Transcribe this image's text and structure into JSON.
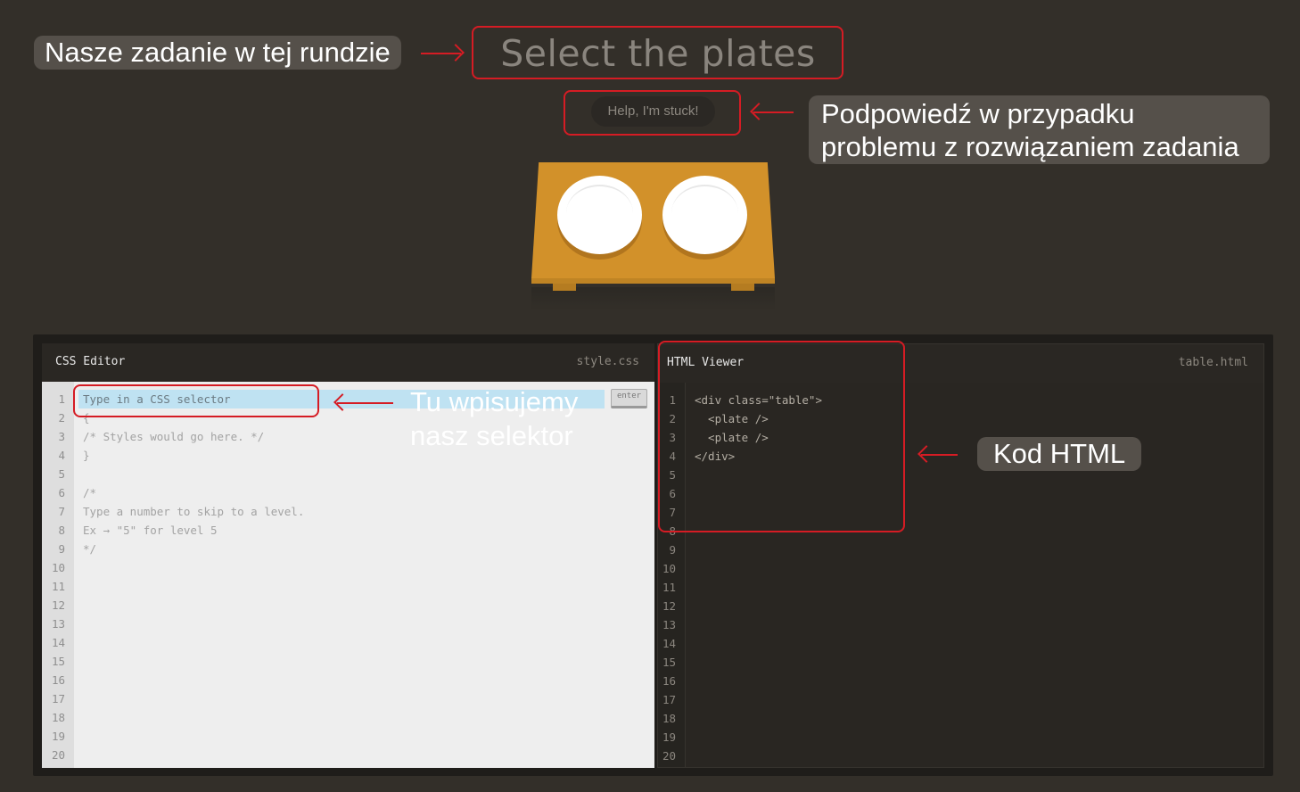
{
  "annotations": {
    "task": "Nasze zadanie w tej rundzie",
    "hint_line1": "Podpowiedź w przypadku",
    "hint_line2": "problemu z rozwiązaniem zadania",
    "selector_line1": "Tu wpisujemy",
    "selector_line2": "nasz selektor",
    "html": "Kod HTML"
  },
  "game": {
    "order": "Select the plates",
    "help_label": "Help, I'm stuck!",
    "plate_count": 2
  },
  "css_editor": {
    "title": "CSS Editor",
    "file": "style.css",
    "input_placeholder": "Type in a CSS selector",
    "enter_label": "enter",
    "lines": [
      "{",
      "/* Styles would go here. */",
      "}",
      "",
      "/*",
      "Type a number to skip to a level.",
      "Ex → \"5\" for level 5",
      "*/"
    ],
    "line_count": 20
  },
  "html_viewer": {
    "title": "HTML Viewer",
    "file": "table.html",
    "lines": [
      "<div class=\"table\">",
      "  <plate />",
      "  <plate />",
      "</div>"
    ],
    "line_count": 20
  },
  "colors": {
    "background": "#332f29",
    "table": "#d2912a",
    "annotation_red": "#d51c24",
    "input_highlight": "#bfe2f2"
  }
}
